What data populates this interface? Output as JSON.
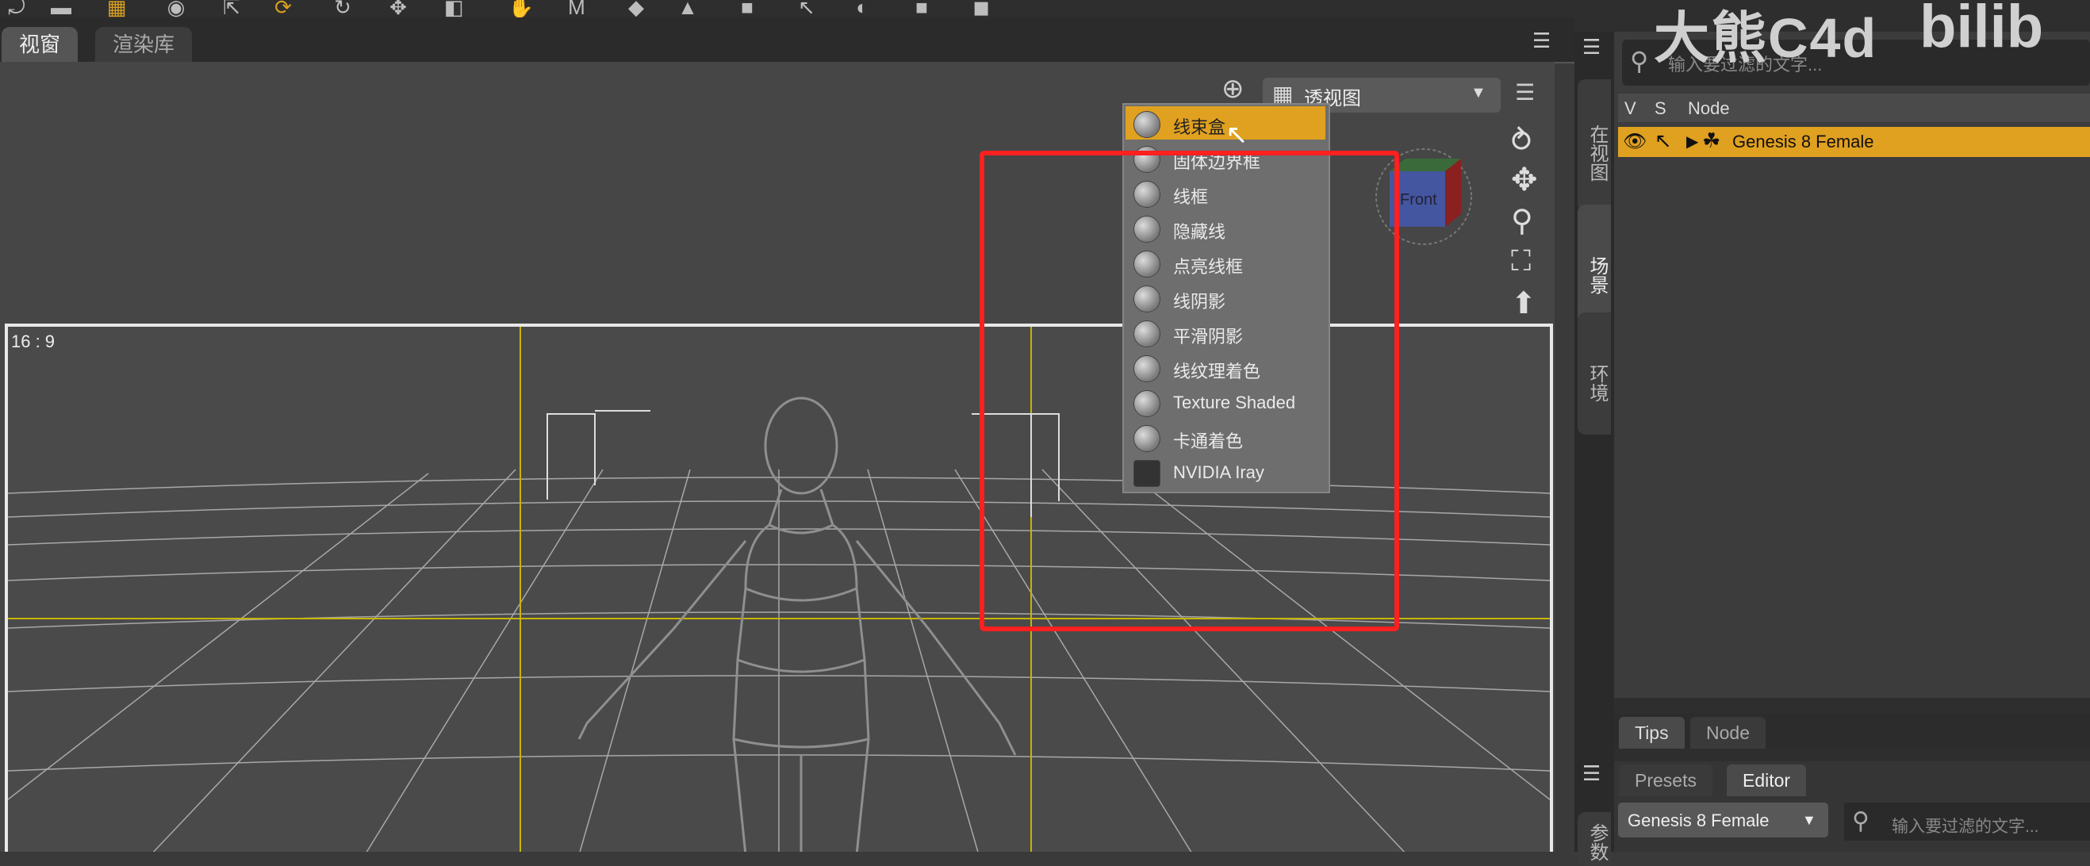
{
  "tabs": {
    "viewport": "视窗",
    "render_library": "渲染库"
  },
  "viewport": {
    "aspect_label": "16 : 9",
    "view_select_label": "透视图"
  },
  "draw_menu": {
    "items": [
      {
        "label": "线束盒",
        "icon": "bounding-box-icon",
        "highlighted": true
      },
      {
        "label": "固体边界框",
        "icon": "solid-box-icon"
      },
      {
        "label": "线框",
        "icon": "wireframe-icon"
      },
      {
        "label": "隐藏线",
        "icon": "hidden-line-icon"
      },
      {
        "label": "点亮线框",
        "icon": "lit-wireframe-icon"
      },
      {
        "label": "线阴影",
        "icon": "wire-shaded-icon"
      },
      {
        "label": "平滑阴影",
        "icon": "smooth-shaded-icon"
      },
      {
        "label": "线纹理着色",
        "icon": "wire-texture-icon"
      },
      {
        "label": "Texture Shaded",
        "icon": "texture-shaded-icon"
      },
      {
        "label": "卡通着色",
        "icon": "cartoon-icon"
      },
      {
        "label": "NVIDIA Iray",
        "icon": "iray-icon"
      }
    ]
  },
  "side_tabs": {
    "in_view": "在视图",
    "scene": "场景",
    "environment": "环境",
    "params": "参数"
  },
  "scene": {
    "search_placeholder": "输入要过滤的文字...",
    "col_v": "V",
    "col_s": "S",
    "col_node": "Node",
    "selected_node": "Genesis 8 Female"
  },
  "bottom": {
    "tips": "Tips",
    "node": "Node",
    "presets": "Presets",
    "editor": "Editor",
    "genesis_dropdown": "Genesis 8 Female",
    "search_placeholder": "输入要过滤的文字..."
  },
  "watermark": {
    "text": "大熊C4d",
    "logo": "bilib"
  },
  "colors": {
    "highlight": "#e0a020",
    "annotation": "#ff2020"
  }
}
